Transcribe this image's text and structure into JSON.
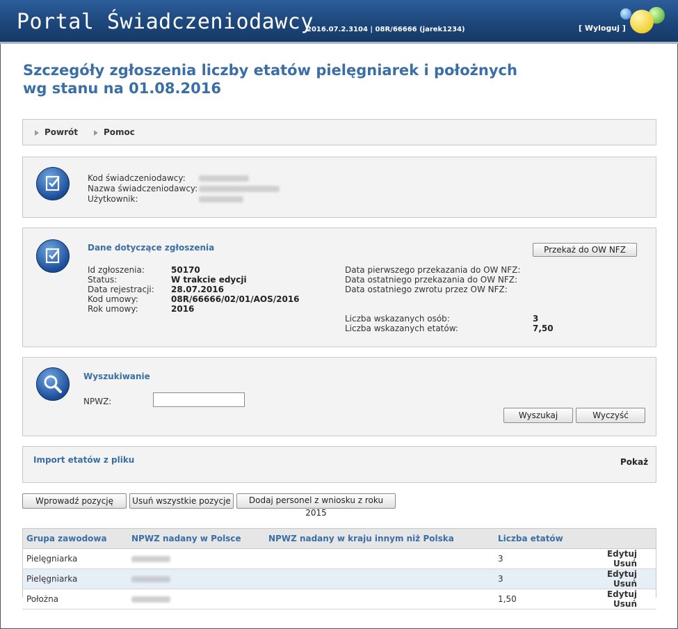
{
  "header": {
    "title": "Portal Świadczeniodawcy",
    "version": "2016.07.2.3104 | 08R/66666 (jarek1234)",
    "logout": "[ Wyloguj ]"
  },
  "page_title_line1": "Szczegóły zgłoszenia liczby etatów pielęgniarek i położnych",
  "page_title_line2": "wg stanu na 01.08.2016",
  "nav": {
    "back": "Powrót",
    "help": "Pomoc"
  },
  "provider": {
    "kod_label": "Kod świadczeniodawcy:",
    "nazwa_label": "Nazwa świadczeniodawcy:",
    "user_label": "Użytkownik:"
  },
  "details": {
    "title": "Dane dotyczące zgłoszenia",
    "send_button": "Przekaż do OW NFZ",
    "id_label": "Id zgłoszenia:",
    "id_value": "50170",
    "status_label": "Status:",
    "status_value": "W trakcie edycji",
    "reg_label": "Data rejestracji:",
    "reg_value": "28.07.2016",
    "contract_label": "Kod umowy:",
    "contract_value": "08R/66666/02/01/AOS/2016",
    "year_label": "Rok umowy:",
    "year_value": "2016",
    "first_send_label": "Data pierwszego przekazania do OW NFZ:",
    "last_send_label": "Data ostatniego przekazania do OW NFZ:",
    "last_return_label": "Data ostatniego zwrotu przez OW NFZ:",
    "persons_label": "Liczba wskazanych osób:",
    "persons_value": "3",
    "fte_label": "Liczba wskazanych etatów:",
    "fte_value": "7,50"
  },
  "search": {
    "title": "Wyszukiwanie",
    "npwz_label": "NPWZ:",
    "npwz_value": "",
    "search_button": "Wyszukaj",
    "clear_button": "Wyczyść"
  },
  "import": {
    "title": "Import etatów z pliku",
    "show": "Pokaż"
  },
  "actions": {
    "add": "Wprowadź pozycję",
    "remove_all": "Usuń wszystkie pozycje",
    "add_from_2015": "Dodaj personel z wniosku z roku 2015"
  },
  "table": {
    "headers": [
      "Grupa zawodowa",
      "NPWZ nadany w Polsce",
      "NPWZ nadany w kraju innym niż Polska",
      "Liczba etatów"
    ],
    "rows": [
      {
        "group": "Pielęgniarka",
        "npwz_foreign": "",
        "fte": "3",
        "edit": "Edytuj",
        "delete": "Usuń"
      },
      {
        "group": "Pielęgniarka",
        "npwz_foreign": "",
        "fte": "3",
        "edit": "Edytuj",
        "delete": "Usuń"
      },
      {
        "group": "Położna",
        "npwz_foreign": "",
        "fte": "1,50",
        "edit": "Edytuj",
        "delete": "Usuń"
      }
    ]
  }
}
